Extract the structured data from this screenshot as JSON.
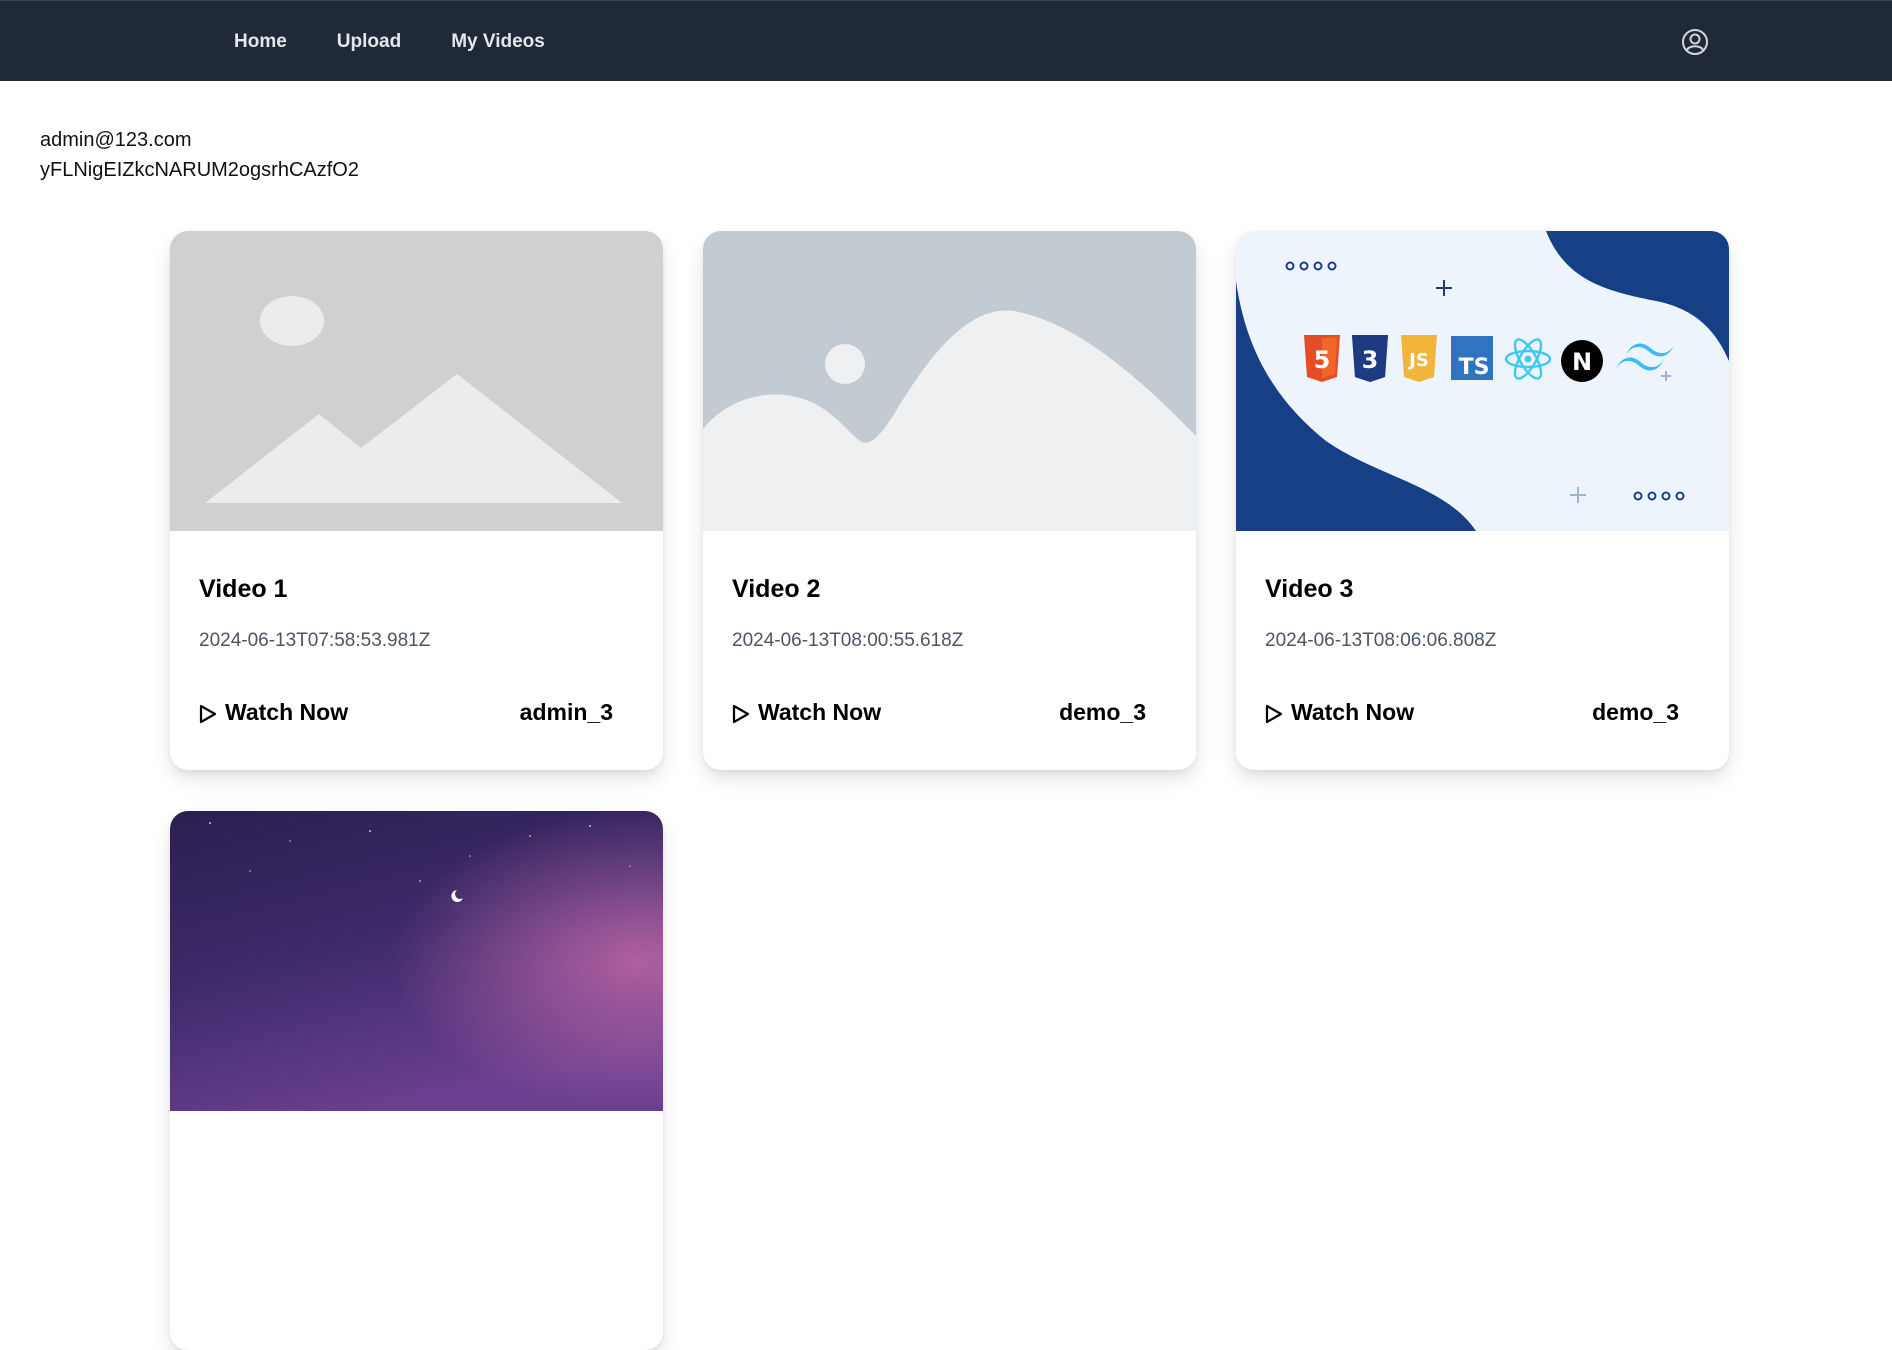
{
  "nav": {
    "home": "Home",
    "upload": "Upload",
    "my_videos": "My Videos"
  },
  "user": {
    "email": "admin@123.com",
    "uid": "yFLNigEIZkcNARUM2ogsrhCAzfO2"
  },
  "videos": [
    {
      "title": "Video 1",
      "date": "2024-06-13T07:58:53.981Z",
      "watch_label": "Watch Now",
      "owner": "admin_3",
      "thumbnail": "placeholder-mountains-icon"
    },
    {
      "title": "Video 2",
      "date": "2024-06-13T08:00:55.618Z",
      "watch_label": "Watch Now",
      "owner": "demo_3",
      "thumbnail": "placeholder-hills-icon"
    },
    {
      "title": "Video 3",
      "date": "2024-06-13T08:06:06.808Z",
      "watch_label": "Watch Now",
      "owner": "demo_3",
      "thumbnail": "web-tech-logos-banner"
    },
    {
      "thumbnail": "night-sky-image"
    }
  ],
  "tech_logos": [
    "5",
    "3",
    "JS",
    "TS",
    "N"
  ],
  "colors": {
    "navbar": "#1f2937",
    "accent_blue": "#1a3f8a"
  }
}
